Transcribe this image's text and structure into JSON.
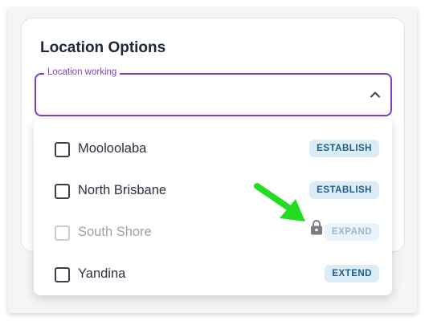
{
  "card": {
    "title": "Location Options"
  },
  "field": {
    "label": "Location working"
  },
  "options": [
    {
      "label": "Mooloolaba",
      "badge": "ESTABLISH",
      "disabled": false
    },
    {
      "label": "North Brisbane",
      "badge": "ESTABLISH",
      "disabled": false
    },
    {
      "label": "South Shore",
      "badge": "EXPAND",
      "disabled": true
    },
    {
      "label": "Yandina",
      "badge": "EXTEND",
      "disabled": false
    }
  ],
  "colors": {
    "accent": "#7e3fbe",
    "badge_bg": "#dcecf7",
    "badge_text": "#1d5c8c",
    "annotation_arrow": "#22dd22"
  },
  "icons": {
    "chevron": "chevron-up-icon",
    "lock": "lock-icon",
    "arrow": "arrow-annotation-icon"
  }
}
